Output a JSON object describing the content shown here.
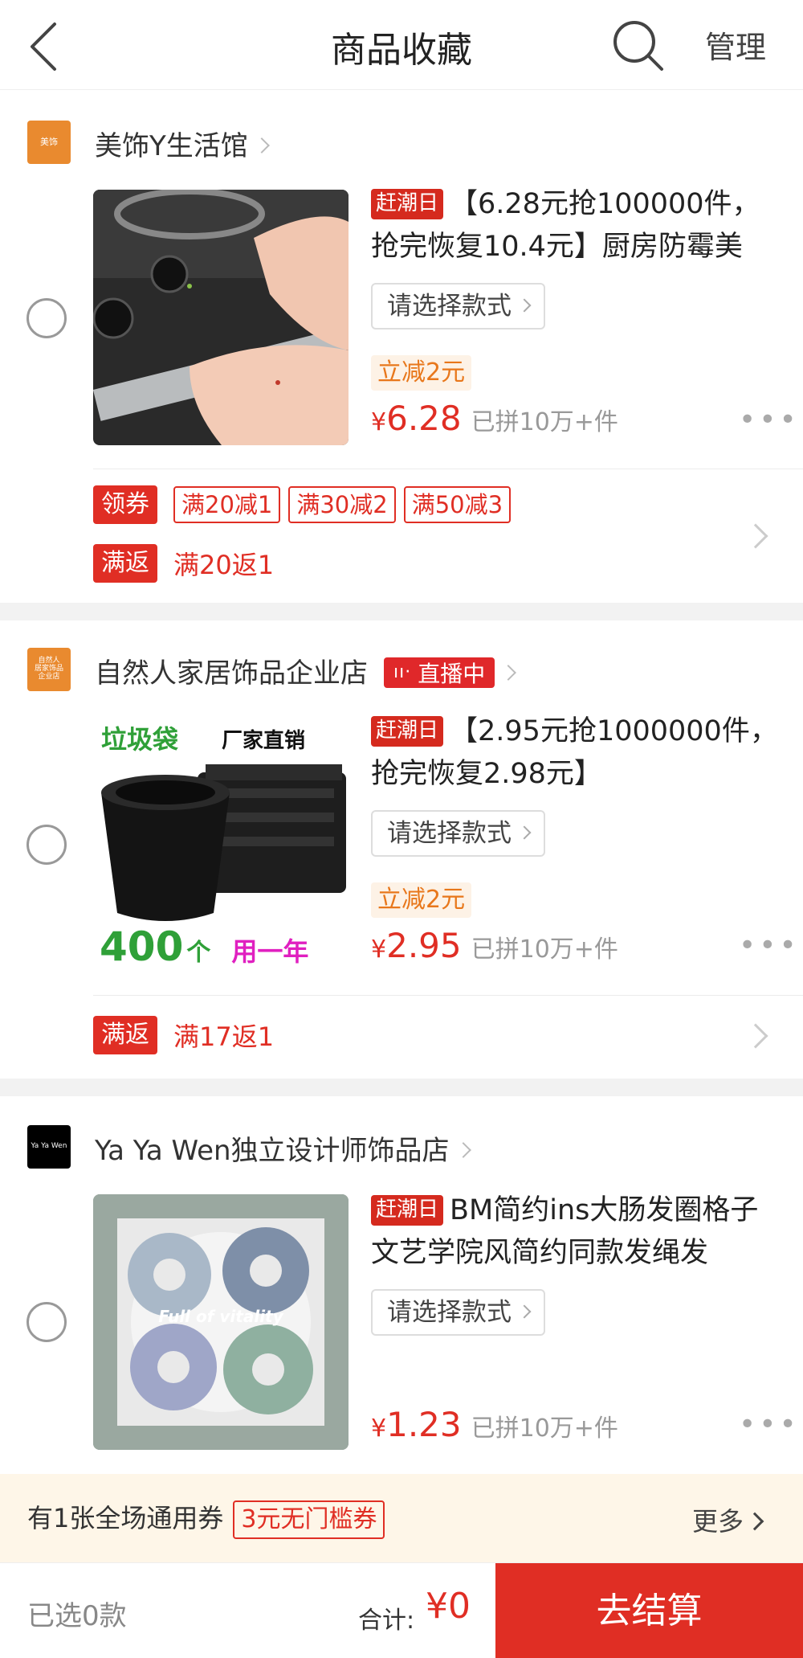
{
  "header": {
    "title": "商品收藏",
    "manage_label": "管理"
  },
  "shops": [
    {
      "logo_text": "美饰",
      "logo_color": "#e98a2f",
      "name": "美饰Y生活馆",
      "live_badge": "",
      "product": {
        "hot_tag": "赶潮日",
        "title": "【6.28元抢100000件，抢完恢复10.4元】厨房防霉美",
        "style_select": "请选择款式",
        "discount": "立减2元",
        "currency": "¥",
        "price": "6.28",
        "sold": "已拼10万+件"
      },
      "promo": {
        "coupon_label": "领券",
        "coupons": [
          "满20减1",
          "满30减2",
          "满50减3"
        ],
        "rebate_label": "满返",
        "rebate_text": "满20返1"
      }
    },
    {
      "logo_text": "自然人\n居家饰品\n企业店",
      "logo_color": "#e98a2f",
      "name": "自然人家居饰品企业店",
      "live_badge": "直播中",
      "product": {
        "hot_tag": "赶潮日",
        "title": "【2.95元抢1000000件，抢完恢复2.98元】",
        "style_select": "请选择款式",
        "discount": "立减2元",
        "currency": "¥",
        "price": "2.95",
        "sold": "已拼10万+件",
        "thumb_text_top_left": "垃圾袋",
        "thumb_text_top_right": "厂家直销",
        "thumb_text_bottom_count": "400",
        "thumb_text_bottom_unit": "个",
        "thumb_text_bottom_right": "用一年"
      },
      "promo": {
        "rebate_label": "满返",
        "rebate_text": "满17返1"
      }
    },
    {
      "logo_text": "Ya Ya Wen",
      "logo_color": "#000000",
      "name": "Ya Ya Wen独立设计师饰品店",
      "live_badge": "",
      "product": {
        "hot_tag": "赶潮日",
        "title": "BM简约ins大肠发圈格子文艺学院风简约同款发绳发",
        "style_select": "请选择款式",
        "currency": "¥",
        "price": "1.23",
        "sold": "已拼10万+件",
        "thumb_overlay_text": "Full of vitality"
      }
    }
  ],
  "coupon_bar": {
    "text": "有1张全场通用券",
    "tag": "3元无门槛券",
    "more": "更多"
  },
  "footer": {
    "selected": "已选0款",
    "total_label": "合计:",
    "total": "¥0",
    "checkout": "去结算"
  },
  "colors": {
    "accent": "#e02e24",
    "discount_text": "#e8771b",
    "discount_bg": "#fdf2e6",
    "coupon_bar_bg": "#fef6e8"
  }
}
